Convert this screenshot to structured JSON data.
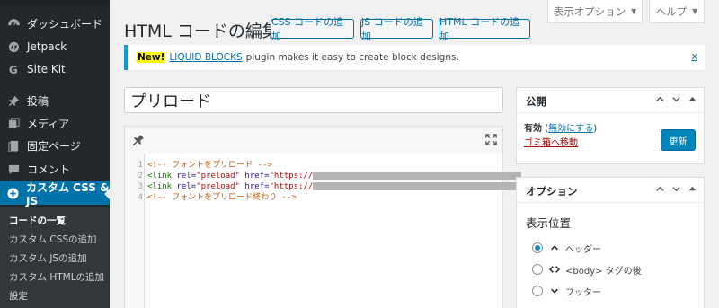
{
  "sidebar": {
    "items": [
      {
        "label": "ダッシュボード",
        "icon": "dashboard-icon"
      },
      {
        "label": "Jetpack",
        "icon": "jetpack-icon"
      },
      {
        "label": "Site Kit",
        "icon": "sitekit-icon"
      },
      {
        "label": "投稿",
        "icon": "pin-icon"
      },
      {
        "label": "メディア",
        "icon": "media-icon"
      },
      {
        "label": "固定ページ",
        "icon": "page-icon"
      },
      {
        "label": "コメント",
        "icon": "comment-icon"
      },
      {
        "label": "カスタム CSS & JS",
        "icon": "plus-circle-icon"
      }
    ],
    "submenu": [
      "コードの一覧",
      "カスタム CSSの追加",
      "カスタム JSの追加",
      "カスタム HTMLの追加",
      "設定"
    ]
  },
  "top_tabs": {
    "screen_options": "表示オプション",
    "help": "ヘルプ"
  },
  "header": {
    "title": "HTML コードの編集",
    "buttons": [
      "CSS コードの追加",
      "JS コードの追加",
      "HTML コードの追加"
    ]
  },
  "notice": {
    "badge": "New!",
    "link": "LIQUID BLOCKS",
    "text": "plugin makes it easy to create block designs.",
    "close": "x"
  },
  "post_title": "プリロード",
  "code_lines": [
    {
      "n": "1",
      "comment": "<!-- フォントをプリロード -->"
    },
    {
      "n": "2",
      "tag": "<link",
      "attr1": "rel=",
      "val1": "\"preload\"",
      "attr2": "href=",
      "val2": "\"https://"
    },
    {
      "n": "3",
      "tag": "<link",
      "attr1": "rel=",
      "val1": "\"preload\"",
      "attr2": "href=",
      "val2": "\"https://"
    },
    {
      "n": "4",
      "comment": "<!-- フォントをプリロード終わり -->"
    }
  ],
  "publish_panel": {
    "title": "公開",
    "status_label": "有効",
    "status_link": "無効にする",
    "trash": "ゴミ箱へ移動",
    "update": "更新"
  },
  "options_panel": {
    "title": "オプション",
    "heading": "表示位置",
    "radios": [
      {
        "label": "ヘッダー",
        "checked": true,
        "icon": "chevron-up-icon"
      },
      {
        "label": "<body> タグの後",
        "checked": false,
        "icon": "code-icon"
      },
      {
        "label": "フッター",
        "checked": false,
        "icon": "chevron-down-icon"
      }
    ]
  },
  "colors": {
    "accent": "#0073aa",
    "sidebar": "#23282d",
    "active": "#0073aa",
    "danger": "#a00"
  }
}
